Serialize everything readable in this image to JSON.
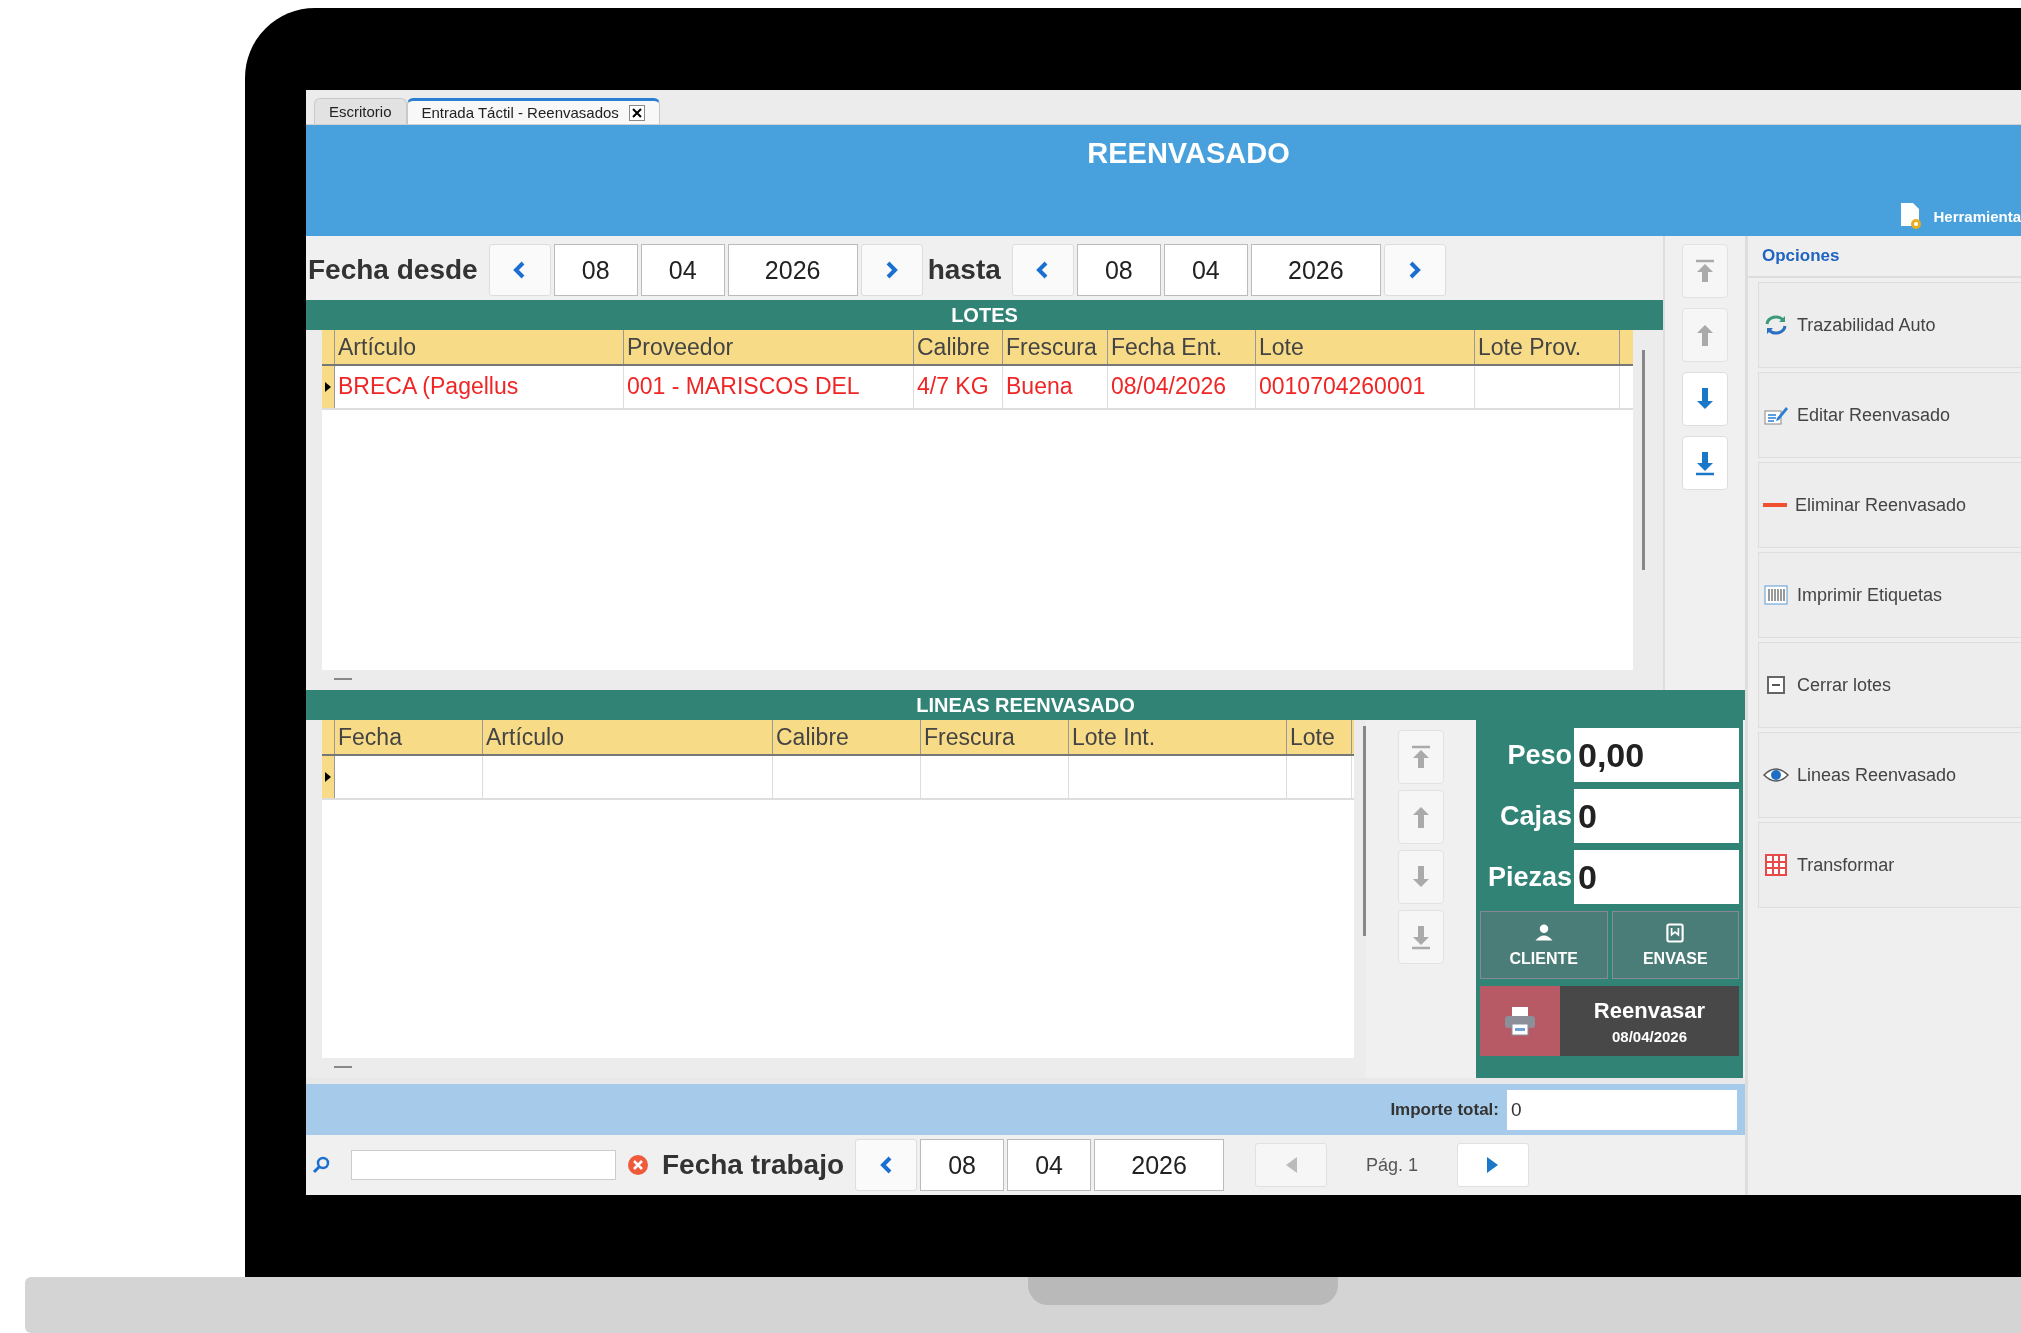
{
  "tabs": [
    {
      "label": "Escritorio",
      "selected": false,
      "closable": false
    },
    {
      "label": "Entrada Táctil - Reenvasados",
      "selected": true,
      "closable": true
    }
  ],
  "header": {
    "title": "REENVASADO",
    "tools_label": "Herramienta"
  },
  "date_filter": {
    "from_label": "Fecha desde",
    "from": {
      "day": "08",
      "month": "04",
      "year": "2026"
    },
    "to_label": "hasta",
    "to": {
      "day": "08",
      "month": "04",
      "year": "2026"
    }
  },
  "lotes": {
    "title": "LOTES",
    "columns": [
      "Artículo",
      "Proveedor",
      "Calibre",
      "Frescura",
      "Fecha Ent.",
      "Lote",
      "Lote Prov."
    ],
    "rows": [
      {
        "selected": true,
        "cells": [
          "BRECA (Pagellus",
          "001 - MARISCOS DEL",
          "4/7 KG",
          "Buena",
          "08/04/2026",
          "0010704260001"
        ]
      }
    ]
  },
  "lotes_nav": [
    {
      "kind": "first",
      "disabled": true
    },
    {
      "kind": "prev",
      "disabled": true
    },
    {
      "kind": "next",
      "disabled": false
    },
    {
      "kind": "last",
      "disabled": false
    }
  ],
  "lineas": {
    "title": "LINEAS REENVASADO",
    "columns": [
      "Fecha",
      "Artículo",
      "Calibre",
      "Frescura",
      "Lote Int.",
      "Lote"
    ],
    "rows": [
      {
        "selected": true
      }
    ]
  },
  "lineas_nav": [
    {
      "kind": "first",
      "disabled": true
    },
    {
      "kind": "prev",
      "disabled": true
    },
    {
      "kind": "next",
      "disabled": true
    },
    {
      "kind": "last",
      "disabled": true
    }
  ],
  "entry": {
    "fields": [
      {
        "label": "Peso",
        "value": "0,00"
      },
      {
        "label": "Cajas",
        "value": "0"
      },
      {
        "label": "Piezas",
        "value": "0"
      }
    ],
    "buttons": [
      {
        "kind": "client",
        "label": "CLIENTE"
      },
      {
        "kind": "container",
        "label": "ENVASE"
      }
    ],
    "submit": {
      "label": "Reenvasar",
      "date": "08/04/2026"
    }
  },
  "total": {
    "label": "Importe total:",
    "value": "0"
  },
  "footer": {
    "work_date_label": "Fecha trabajo",
    "work_date": {
      "day": "08",
      "month": "04",
      "year": "2026"
    },
    "page": {
      "label": "Pág. 1",
      "prev_disabled": true,
      "next_disabled": false
    }
  },
  "options": {
    "title": "Opciones",
    "items": [
      {
        "kind": "refresh",
        "label": "Trazabilidad Auto"
      },
      {
        "kind": "edit",
        "label": "Editar Reenvasado"
      },
      {
        "kind": "remove",
        "label": "Eliminar Reenvasado"
      },
      {
        "kind": "labels",
        "label": "Imprimir Etiquetas"
      },
      {
        "kind": "close-box",
        "label": "Cerrar lotes"
      },
      {
        "kind": "eye",
        "label": "Lineas Reenvasado"
      },
      {
        "kind": "transform",
        "label": "Transformar"
      }
    ]
  }
}
